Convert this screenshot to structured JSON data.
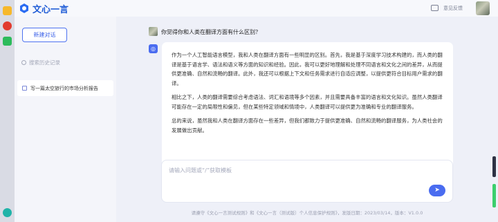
{
  "header": {
    "app_name": "文心一言",
    "feedback_label": "意见反馈"
  },
  "sidebar": {
    "new_chat_label": "新建对话",
    "search_placeholder": "搜索历史记录",
    "history": [
      {
        "title": "写一篇太空旅行的市场分析报告"
      }
    ]
  },
  "conversation": {
    "user_message": "你觉得你和人类在翻译方面有什么区别？",
    "bot_icon_glyph": "◎",
    "answer_paragraphs": [
      "作为一个人工智能语言模型，我和人类在翻译方面有一些明显的区别。首先，我是基于深度学习技术构建的，而人类的翻译是基于语言学、语法和语义等方面的知识和经验。因此，我可以更好地理解和处理不同语言和文化之间的差异，从而提供更准确、自然和流畅的翻译。此外，我还可以根据上下文和任务需求进行自适应调整，以提供更符合目标用户需求的翻译。",
      "相比之下，人类的翻译需要综合考虑语法、词汇和语境等多个因素，并且需要具备丰富的语言和文化知识。虽然人类翻译可能存在一定的局限性和偏见，但在某些特定领域和情境中，人类翻译可以提供更为准确和专业的翻译服务。",
      "总的来说，虽然我和人类在翻译方面存在一些差异，但我们都致力于提供更准确、自然和流畅的翻译服务，为人类社会的发展做出贡献。"
    ]
  },
  "input": {
    "placeholder": "请输入问题或“/”获取模板",
    "value": "",
    "send_glyph": "➤"
  },
  "footer": {
    "text": "请遵守《文心一言测试规则》和《文心一言（测试版）个人信息保护规则》，发版日期：2023/03/14，版本：V1.0.0"
  },
  "colors": {
    "accent": "#4a6cf0",
    "brand": "#1e5bd6",
    "background": "#eef0f8"
  }
}
